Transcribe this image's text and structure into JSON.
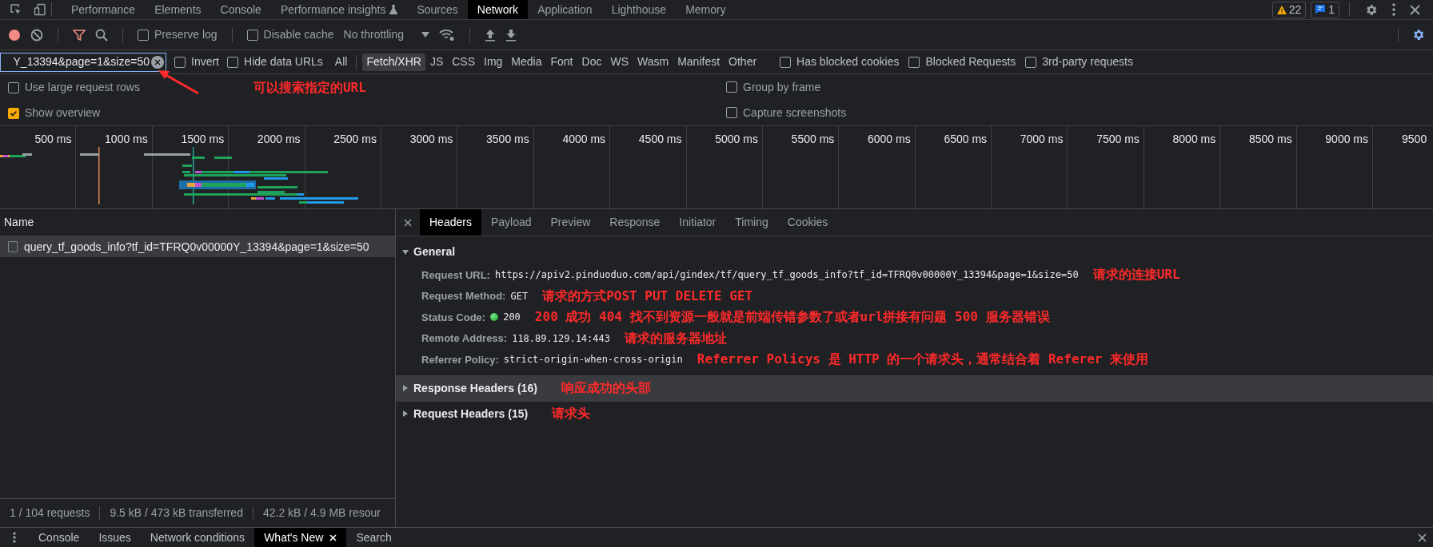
{
  "main_tabs": [
    {
      "label": "Performance",
      "selected": false,
      "experimental": false
    },
    {
      "label": "Elements",
      "selected": false,
      "experimental": false
    },
    {
      "label": "Console",
      "selected": false,
      "experimental": false
    },
    {
      "label": "Performance insights",
      "selected": false,
      "experimental": true
    },
    {
      "label": "Sources",
      "selected": false,
      "experimental": false
    },
    {
      "label": "Network",
      "selected": true,
      "experimental": false
    },
    {
      "label": "Application",
      "selected": false,
      "experimental": false
    },
    {
      "label": "Lighthouse",
      "selected": false,
      "experimental": false
    },
    {
      "label": "Memory",
      "selected": false,
      "experimental": false
    }
  ],
  "issue_counts": {
    "warnings": "22",
    "messages": "1"
  },
  "toolbar": {
    "recording": true,
    "filter_active": true,
    "checks": [
      {
        "label": "Preserve log",
        "checked": false
      },
      {
        "label": "Disable cache",
        "checked": false
      }
    ],
    "throttling": "No throttling"
  },
  "filter": {
    "value": "Y_13394&page=1&size=50",
    "note": "可以搜索指定的URL",
    "checks": [
      {
        "label": "Invert",
        "checked": false
      },
      {
        "label": "Hide data URLs",
        "checked": false
      }
    ],
    "types": [
      {
        "label": "All",
        "selected": false
      },
      {
        "label": "Fetch/XHR",
        "selected": true
      },
      {
        "label": "JS",
        "selected": false
      },
      {
        "label": "CSS",
        "selected": false
      },
      {
        "label": "Img",
        "selected": false
      },
      {
        "label": "Media",
        "selected": false
      },
      {
        "label": "Font",
        "selected": false
      },
      {
        "label": "Doc",
        "selected": false
      },
      {
        "label": "WS",
        "selected": false
      },
      {
        "label": "Wasm",
        "selected": false
      },
      {
        "label": "Manifest",
        "selected": false
      },
      {
        "label": "Other",
        "selected": false
      }
    ],
    "extra_checks": [
      {
        "label": "Has blocked cookies",
        "checked": false
      },
      {
        "label": "Blocked Requests",
        "checked": false
      },
      {
        "label": "3rd-party requests",
        "checked": false
      }
    ]
  },
  "options_left": [
    {
      "label": "Use large request rows",
      "checked": false
    },
    {
      "label": "Show overview",
      "checked": true
    }
  ],
  "options_right": [
    {
      "label": "Group by frame",
      "checked": false
    },
    {
      "label": "Capture screenshots",
      "checked": false
    }
  ],
  "timeline_ticks": [
    "500 ms",
    "1000 ms",
    "1500 ms",
    "2000 ms",
    "2500 ms",
    "3000 ms",
    "3500 ms",
    "4000 ms",
    "4500 ms",
    "5000 ms",
    "5500 ms",
    "6000 ms",
    "6500 ms",
    "7000 ms",
    "7500 ms",
    "8000 ms",
    "8500 ms",
    "9000 ms",
    "9500"
  ],
  "requests": {
    "column": "Name",
    "rows": [
      {
        "name": "query_tf_goods_info?tf_id=TFRQ0v00000Y_13394&page=1&size=50",
        "selected": true
      }
    ]
  },
  "status_bar": [
    "1 / 104 requests",
    "9.5 kB / 473 kB transferred",
    "42.2 kB / 4.9 MB resour"
  ],
  "detail_tabs": [
    {
      "label": "Headers",
      "selected": true
    },
    {
      "label": "Payload",
      "selected": false
    },
    {
      "label": "Preview",
      "selected": false
    },
    {
      "label": "Response",
      "selected": false
    },
    {
      "label": "Initiator",
      "selected": false
    },
    {
      "label": "Timing",
      "selected": false
    },
    {
      "label": "Cookies",
      "selected": false
    }
  ],
  "sections": [
    {
      "title": "General",
      "expanded": true,
      "hovered": false,
      "fields": [
        {
          "kind": "text",
          "label": "Request URL:",
          "value": "https://apiv2.pinduoduo.com/api/gindex/tf/query_tf_goods_info?tf_id=TFRQ0v00000Y_13394&page=1&size=50",
          "note": "请求的连接URL"
        },
        {
          "kind": "text",
          "label": "Request Method:",
          "value": "GET",
          "note": "请求的方式POST PUT DELETE GET"
        },
        {
          "kind": "status",
          "label": "Status Code:",
          "value": "200",
          "note": "200 成功 404 找不到资源一般就是前端传错参数了或者url拼接有问题 500 服务器错误"
        },
        {
          "kind": "text",
          "label": "Remote Address:",
          "value": "118.89.129.14:443",
          "note": "请求的服务器地址"
        },
        {
          "kind": "text",
          "label": "Referrer Policy:",
          "value": "strict-origin-when-cross-origin",
          "note": "Referrer Policys 是 HTTP 的一个请求头，通常结合着 Referer 来使用"
        }
      ]
    },
    {
      "title": "Response Headers (16)",
      "expanded": false,
      "hovered": true,
      "note": "响应成功的头部"
    },
    {
      "title": "Request Headers (15)",
      "expanded": false,
      "hovered": false,
      "note": "请求头"
    }
  ],
  "drawer_tabs": [
    {
      "label": "Console",
      "selected": false
    },
    {
      "label": "Issues",
      "selected": false
    },
    {
      "label": "Network conditions",
      "selected": false
    },
    {
      "label": "What's New",
      "selected": true
    },
    {
      "label": "Search",
      "selected": false
    }
  ]
}
